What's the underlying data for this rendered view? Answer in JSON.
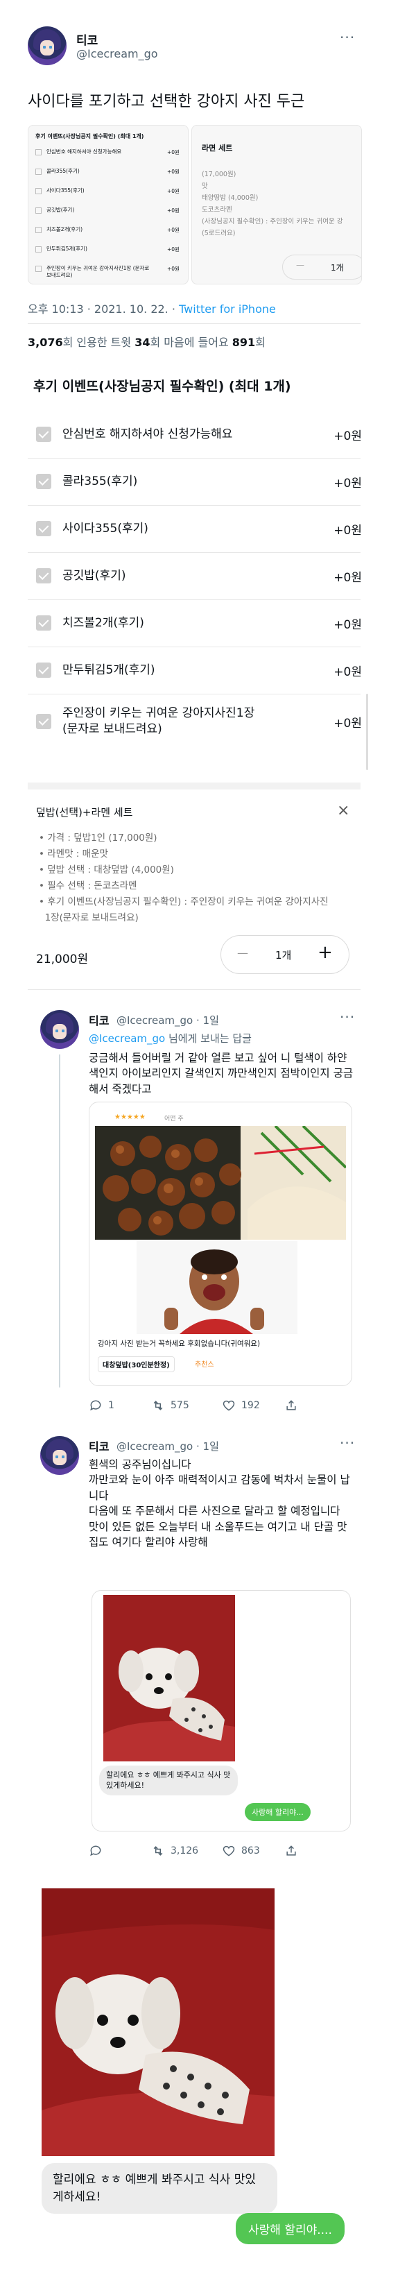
{
  "tweet": {
    "display_name": "티코",
    "handle": "@Icecream_go",
    "text": "사이다를 포기하고 선택한 강아지 사진 두근",
    "meta_time": "오후 10:13 · 2021. 10. 22. · ",
    "meta_source": "Twitter for iPhone",
    "stats": {
      "retweets": "3,076",
      "retweets_label": "회  인용한 트윗 ",
      "quotes": "34",
      "quotes_label": "회  마음에 들어요 ",
      "likes": "891",
      "likes_label": "회"
    }
  },
  "thumb": {
    "left_title": "후기 이벤뜨(사장님공지 필수확인) (최대 1개)",
    "left_rows": [
      "안심번호 해지하셔야 신청가능해요",
      "콜라355(후기)",
      "사이다355(후기)",
      "공깃밥(후기)",
      "치즈볼2개(후기)",
      "만두튀김5개(후기)",
      "주인장이 키우는 귀여운 강아지사진1장 (문자로 보내드려요)"
    ],
    "left_price": "+0원",
    "right_title": "라면 세트",
    "right_lines": [
      "(17,000원)",
      "맛",
      "태양땅밥 (4,000원)",
      "도코츠라멘",
      "(사장님공지 필수확인) : 주인장이 키우는 귀여운 강",
      "(5로드려요)"
    ],
    "right_qty": "1개"
  },
  "options": {
    "title": "후기 이벤뜨(사장님공지 필수확인) (최대 1개)",
    "items": [
      {
        "label": "안심번호 해지하셔야 신청가능해요",
        "price": "+0원"
      },
      {
        "label": "콜라355(후기)",
        "price": "+0원"
      },
      {
        "label": "사이다355(후기)",
        "price": "+0원"
      },
      {
        "label": "공깃밥(후기)",
        "price": "+0원"
      },
      {
        "label": "치즈볼2개(후기)",
        "price": "+0원"
      },
      {
        "label": "만두튀김5개(후기)",
        "price": "+0원"
      },
      {
        "label": "주인장이 키우는 귀여운 강아지사진1장\n(문자로 보내드려요)",
        "price": "+0원"
      }
    ]
  },
  "cart": {
    "title": "덮밥(선택)+라멘 세트",
    "lines": [
      "• 가격 : 덮밥1인 (17,000원)",
      "• 라멘맛 : 매운맛",
      "• 덮밥 선택 : 대창덮밥 (4,000원)",
      "• 필수 선택 : 돈코츠라멘",
      "• 후기 이벤뜨(사장님공지 필수확인) : 주인장이 키우는 귀여운 강아지사진",
      "  1장(문자로 보내드려요)"
    ],
    "price": "21,000원",
    "qty": "1개",
    "minus": "—",
    "plus": "+"
  },
  "reply1": {
    "display_name": "티코",
    "handle": "@Icecream_go · 1일",
    "reply_to_name": "@Icecream_go",
    "reply_to_suffix": " 님에게 보내는 답글",
    "text": "궁금해서 들어버릴 거 같아 얼른 보고 싶어 니 털색이 하얀색인지 아이보리인지 갈색인지 까만색인지 점박이인지 궁금해서 죽겠다고",
    "review_stars": "★★★★★",
    "review_date": "어떤 주",
    "review_text": "강아지 사진 받는거 꼭하세요 후회없습니다(귀여워요)",
    "review_tag": "대창덮밥(30인분한정)",
    "review_tag2": "추천스",
    "actions": {
      "replies": "1",
      "retweets": "575",
      "likes": "192"
    }
  },
  "reply2": {
    "display_name": "티코",
    "handle": "@Icecream_go · 1일",
    "text": "흰색의 공주님이십니다\n까만코와 눈이 아주 매력적이시고 감동에 벅차서 눈물이 납니다\n다음에 또 주문해서 다른 사진으로 달라고 할 예정입니다\n맛이 있든 없든 오늘부터 내 소울푸드는 여기고 내 단골 맛집도 여기다 할리야 사랑해",
    "small_bubble": "할리에요 ㅎㅎ 예쁘게 봐주시고 식사 맛있게하세요!",
    "small_reply": "사랑해 할리야...",
    "actions": {
      "replies": "",
      "retweets": "3,126",
      "likes": "863"
    }
  },
  "chat": {
    "message": "할리에요 ㅎㅎ 예쁘게 봐주시고 식사 맛있게하세요!",
    "reply": "사랑해 할리야...."
  },
  "colors": {
    "accent": "#1d9bf0",
    "green": "#53c653"
  }
}
